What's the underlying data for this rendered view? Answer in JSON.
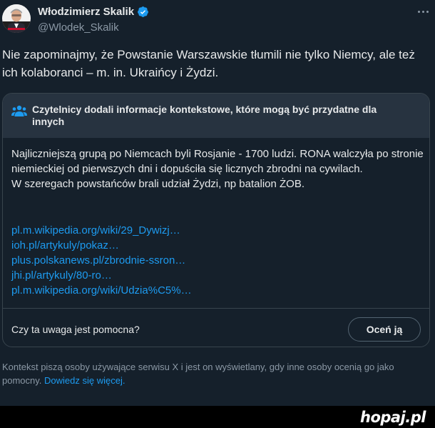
{
  "colors": {
    "background": "#15202b",
    "text": "#e7e9ea",
    "secondary_text": "#8b98a5",
    "link": "#1d9bf0",
    "note_header_bg": "#273340",
    "border": "#38444d",
    "verified": "#1d9bf0"
  },
  "author": {
    "display_name": "Włodzimierz Skalik",
    "handle": "@Wlodek_Skalik",
    "verified_icon": "verified-badge-icon",
    "more_icon": "more-options-icon"
  },
  "tweet": {
    "text": "Nie zapominajmy, że Powstanie Warszawskie tłumili nie tylko Niemcy, ale też ich kolaboranci – m. in. Ukraińcy i Żydzi."
  },
  "community_note": {
    "icon": "people-icon",
    "title": "Czytelnicy dodali informacje kontekstowe, które mogą być przydatne dla innych",
    "body_line_1": "Najliczniejszą grupą po Niemcach byli Rosjanie - 1700 ludzi. RONA walczyła po stronie niemieckiej od pierwszych dni i dopuściła się licznych zbrodni na cywilach.",
    "body_line_2": "W szeregach powstańców brali udział Żydzi, np batalion ŻOB.",
    "links": [
      "pl.m.wikipedia.org/wiki/29_Dywizj…",
      "ioh.pl/artykuly/pokaz…",
      "plus.polskanews.pl/zbrodnie-ssron…",
      "jhi.pl/artykuly/80-ro…",
      "pl.m.wikipedia.org/wiki/Udzia%C5%…"
    ],
    "helpful_question": "Czy ta uwaga jest pomocna?",
    "rate_button": "Oceń ją"
  },
  "footer": {
    "text": "Kontekst piszą osoby używające serwisu X i jest on wyświetlany, gdy inne osoby ocenią go jako pomocny.",
    "link": "Dowiedz się więcej."
  },
  "watermark": "hopaj.pl"
}
